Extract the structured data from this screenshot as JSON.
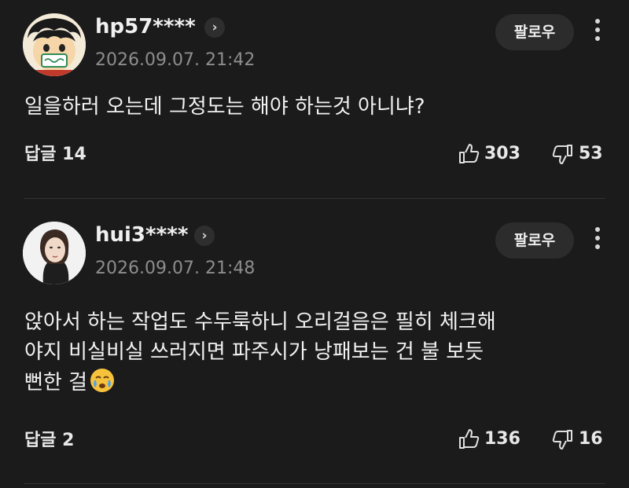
{
  "comments": [
    {
      "username": "hp57****",
      "date": "2026.09.07. 21:42",
      "follow_label": "팔로우",
      "body": [
        "일을하러 오는데 그정도는 해야 하는것 아니냐?"
      ],
      "reply_label": "답글 14",
      "likes": "303",
      "dislikes": "53",
      "avatar_icon": "cartoon-avatar-icon"
    },
    {
      "username": "hui3****",
      "date": "2026.09.07. 21:48",
      "follow_label": "팔로우",
      "body": [
        "앉아서 하는 작업도 수두룩하니 오리걸음은 필히 체크해",
        "야지 비실비실 쓰러지면 파주시가 낭패보는 건 불 보듯",
        "뻔한 걸"
      ],
      "reply_label": "답글 2",
      "likes": "136",
      "dislikes": "16",
      "avatar_icon": "photo-avatar-icon",
      "emoji_icon": "crying-face-emoji-icon"
    }
  ],
  "colors": {
    "background": "#1b1b1b",
    "text": "#f2f2f2",
    "muted": "#8d8d8d",
    "button_bg": "#2c2c2c",
    "divider": "#333333"
  }
}
